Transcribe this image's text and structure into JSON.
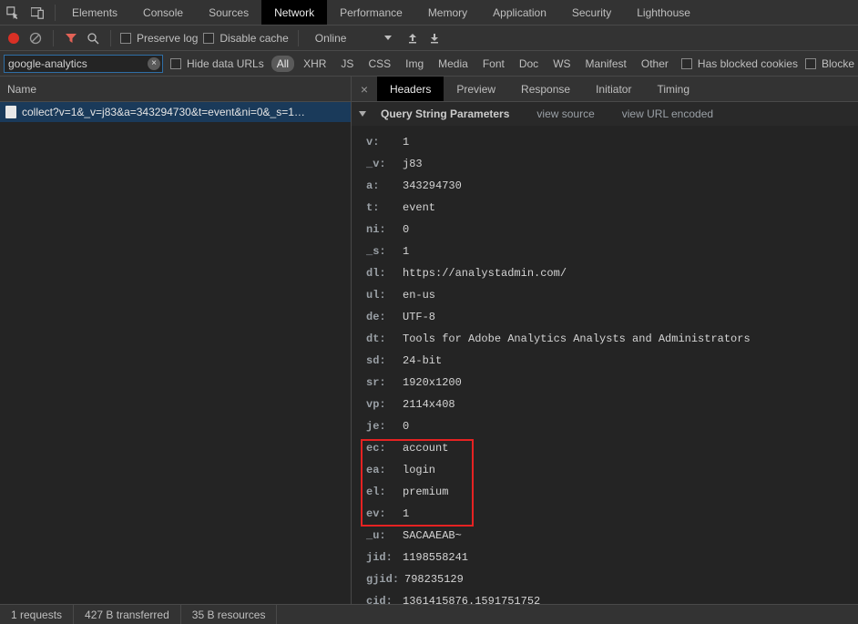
{
  "mainTabs": [
    "Elements",
    "Console",
    "Sources",
    "Network",
    "Performance",
    "Memory",
    "Application",
    "Security",
    "Lighthouse"
  ],
  "mainTabActive": "Network",
  "toolbar": {
    "preserve_log": "Preserve log",
    "disable_cache": "Disable cache",
    "throttle": "Online"
  },
  "filter": {
    "value": "google-analytics",
    "hide_data_urls": "Hide data URLs",
    "types": [
      "All",
      "XHR",
      "JS",
      "CSS",
      "Img",
      "Media",
      "Font",
      "Doc",
      "WS",
      "Manifest",
      "Other"
    ],
    "type_active": "All",
    "blocked_cookies": "Has blocked cookies",
    "blocked_requests": "Blocke"
  },
  "leftHeader": "Name",
  "requestName": "collect?v=1&_v=j83&a=343294730&t=event&ni=0&_s=1…",
  "detailTabs": [
    "Headers",
    "Preview",
    "Response",
    "Initiator",
    "Timing"
  ],
  "detailTabActive": "Headers",
  "section": {
    "title": "Query String Parameters",
    "view_source": "view source",
    "view_url_encoded": "view URL encoded"
  },
  "params": [
    {
      "k": "v",
      "v": "1"
    },
    {
      "k": "_v",
      "v": "j83"
    },
    {
      "k": "a",
      "v": "343294730"
    },
    {
      "k": "t",
      "v": "event"
    },
    {
      "k": "ni",
      "v": "0"
    },
    {
      "k": "_s",
      "v": "1"
    },
    {
      "k": "dl",
      "v": "https://analystadmin.com/"
    },
    {
      "k": "ul",
      "v": "en-us"
    },
    {
      "k": "de",
      "v": "UTF-8"
    },
    {
      "k": "dt",
      "v": "Tools for Adobe Analytics Analysts and Administrators"
    },
    {
      "k": "sd",
      "v": "24-bit"
    },
    {
      "k": "sr",
      "v": "1920x1200"
    },
    {
      "k": "vp",
      "v": "2114x408"
    },
    {
      "k": "je",
      "v": "0"
    },
    {
      "k": "ec",
      "v": "account"
    },
    {
      "k": "ea",
      "v": "login"
    },
    {
      "k": "el",
      "v": "premium"
    },
    {
      "k": "ev",
      "v": "1"
    },
    {
      "k": "_u",
      "v": "SACAAEAB~"
    },
    {
      "k": "jid",
      "v": "1198558241"
    },
    {
      "k": "gjid",
      "v": "798235129"
    },
    {
      "k": "cid",
      "v": "1361415876.1591751752"
    }
  ],
  "status": {
    "requests": "1 requests",
    "transferred": "427 B transferred",
    "resources": "35 B resources"
  }
}
